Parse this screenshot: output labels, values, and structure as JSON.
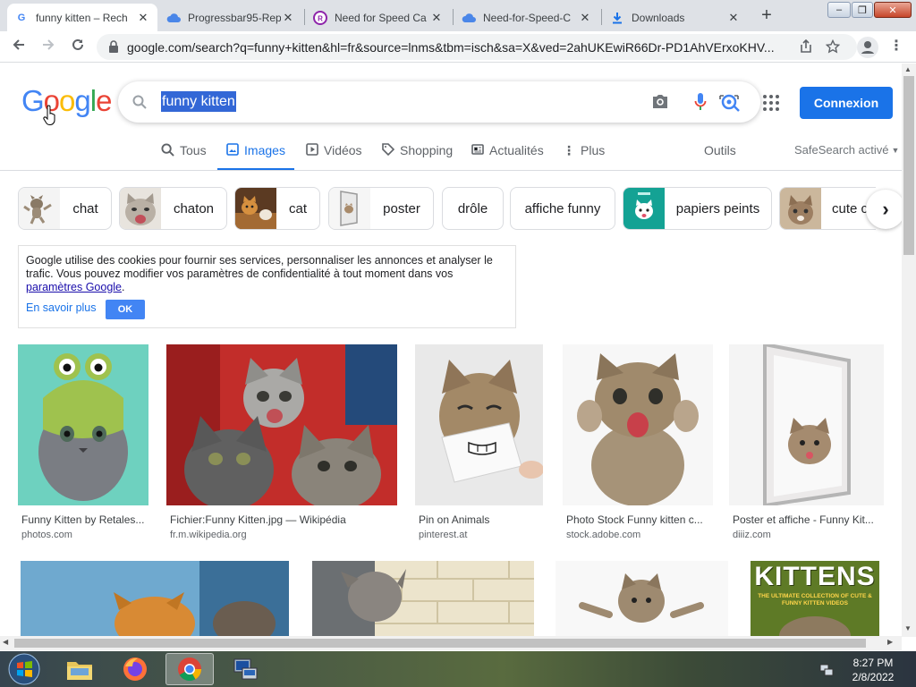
{
  "browser": {
    "tabs": [
      {
        "title": "funny kitten – Rech",
        "favicon": "G",
        "color": "#4285f4",
        "active": true
      },
      {
        "title": "Progressbar95-Rep",
        "favicon": "cloud",
        "color": "#4a86e8",
        "active": false
      },
      {
        "title": "Need for Speed Ca",
        "favicon": "circle",
        "color": "#8e24aa",
        "active": false
      },
      {
        "title": "Need-for-Speed-C",
        "favicon": "cloud",
        "color": "#4a86e8",
        "active": false
      },
      {
        "title": "Downloads",
        "favicon": "download",
        "color": "#1a73e8",
        "active": false
      }
    ],
    "new_tab": "+",
    "window_controls": {
      "minimize": "–",
      "restore": "❐",
      "close": "✕"
    },
    "url": "google.com/search?q=funny+kitten&hl=fr&source=lnms&tbm=isch&sa=X&ved=2ahUKEwiR66Dr-PD1AhVErxoKHV..."
  },
  "google": {
    "logo_letters": [
      {
        "ch": "G",
        "color": "#4285f4"
      },
      {
        "ch": "o",
        "color": "#ea4335"
      },
      {
        "ch": "o",
        "color": "#fbbc05"
      },
      {
        "ch": "g",
        "color": "#4285f4"
      },
      {
        "ch": "l",
        "color": "#34a853"
      },
      {
        "ch": "e",
        "color": "#ea4335"
      }
    ],
    "query": "funny kitten",
    "login": "Connexion"
  },
  "search_tabs": [
    {
      "label": "Tous",
      "icon": "search-icon",
      "active": false
    },
    {
      "label": "Images",
      "icon": "image-icon",
      "active": true
    },
    {
      "label": "Vidéos",
      "icon": "video-icon",
      "active": false
    },
    {
      "label": "Shopping",
      "icon": "tag-icon",
      "active": false
    },
    {
      "label": "Actualités",
      "icon": "news-icon",
      "active": false
    },
    {
      "label": "Plus",
      "icon": "more-icon",
      "active": false
    }
  ],
  "tools_label": "Outils",
  "safesearch": "SafeSearch activé",
  "chips": [
    "chat",
    "chaton",
    "cat",
    "poster",
    "drôle",
    "affiche funny",
    "papiers peints",
    "cute c"
  ],
  "cookie": {
    "text": "Google utilise des cookies pour fournir ses services, personnaliser les annonces et analyser le trafic. Vous pouvez modifier vos paramètres de confidentialité à tout moment dans vos",
    "link": "paramètres Google",
    "after": ".",
    "learn_more": "En savoir plus",
    "ok": "OK"
  },
  "images": [
    {
      "caption": "Funny Kitten by Retales...",
      "source": "photos.com"
    },
    {
      "caption": "Fichier:Funny Kitten.jpg — Wikipédia",
      "source": "fr.m.wikipedia.org"
    },
    {
      "caption": "Pin on Animals",
      "source": "pinterest.at"
    },
    {
      "caption": "Photo Stock Funny kitten c...",
      "source": "stock.adobe.com"
    },
    {
      "caption": "Poster et affiche - Funny Kit...",
      "source": "diiiz.com"
    }
  ],
  "row2_banner": "KITTENS",
  "row2_banner_sub": "THE ULTIMATE COLLECTION OF CUTE & FUNNY KITTEN VIDEOS",
  "taskbar": {
    "time": "8:27 PM",
    "date": "2/8/2022"
  }
}
